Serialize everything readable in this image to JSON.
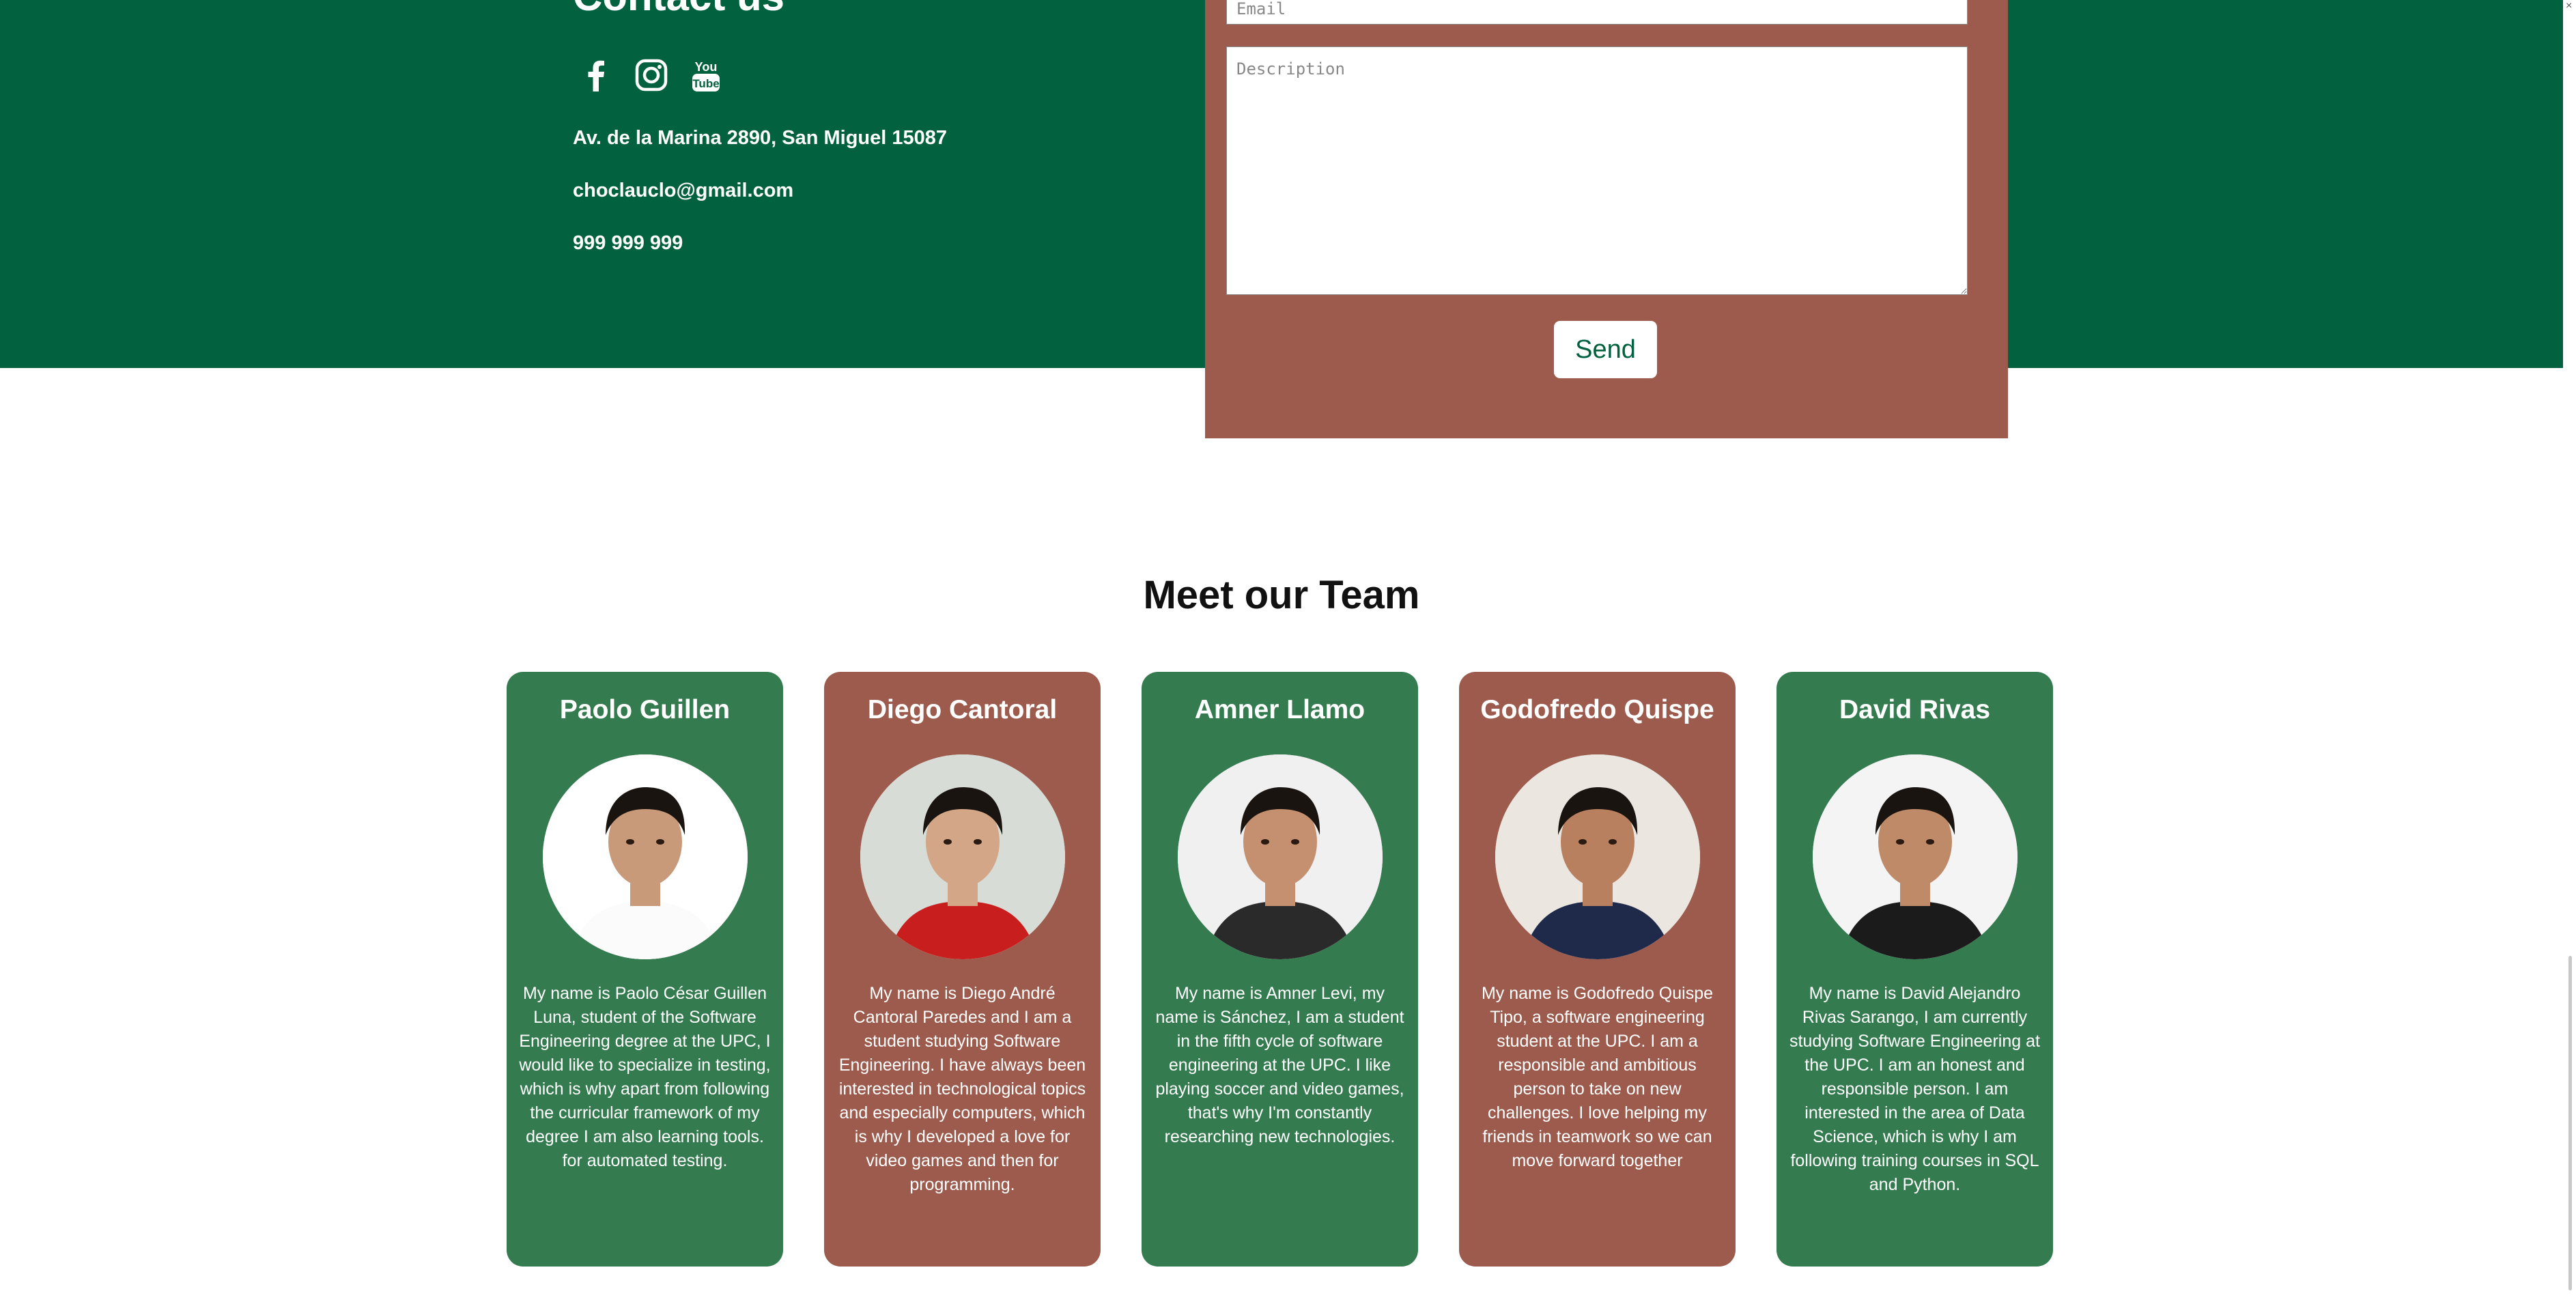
{
  "contact": {
    "title": "Contact us",
    "social": [
      {
        "icon": "facebook-icon"
      },
      {
        "icon": "instagram-icon"
      },
      {
        "icon": "youtube-icon",
        "label_top": "You",
        "label_bottom": "Tube"
      }
    ],
    "address": "Av. de la Marina 2890, San Miguel 15087",
    "email": "choclauclo@gmail.com",
    "phone": "999 999 999"
  },
  "form": {
    "email_placeholder": "Email",
    "description_placeholder": "Description",
    "send_label": "Send"
  },
  "team": {
    "title": "Meet our Team",
    "members": [
      {
        "name": "Paolo Guillen",
        "bio": "My name is Paolo César Guillen Luna, student of the Software Engineering degree at the UPC, I would like to specialize in testing, which is why apart from following the curricular framework of my degree I am also learning tools. for automated testing.",
        "color": "#347c50"
      },
      {
        "name": "Diego Cantoral",
        "bio": "My name is Diego André Cantoral Paredes and I am a student studying Software Engineering. I have always been interested in technological topics and especially computers, which is why I developed a love for video games and then for programming.",
        "color": "#9c5b4d"
      },
      {
        "name": "Amner Llamo",
        "bio": "My name is Amner Levi, my name is Sánchez, I am a student in the fifth cycle of software engineering at the UPC. I like playing soccer and video games, that's why I'm constantly researching new technologies.",
        "color": "#347c50"
      },
      {
        "name": "Godofredo Quispe",
        "bio": "My name is Godofredo Quispe Tipo, a software engineering student at the UPC. I am a responsible and ambitious person to take on new challenges. I love helping my friends in teamwork so we can move forward together",
        "color": "#9c5b4d"
      },
      {
        "name": "David Rivas",
        "bio": "My name is David Alejandro Rivas Sarango, I am currently studying Software Engineering at the UPC. I am an honest and responsible person. I am interested in the area of Data Science, which is why I am following training courses in SQL and Python.",
        "color": "#347c50"
      }
    ]
  },
  "colors": {
    "brand_green": "#02613f",
    "card_green": "#347c50",
    "card_brown": "#9c5b4d"
  }
}
